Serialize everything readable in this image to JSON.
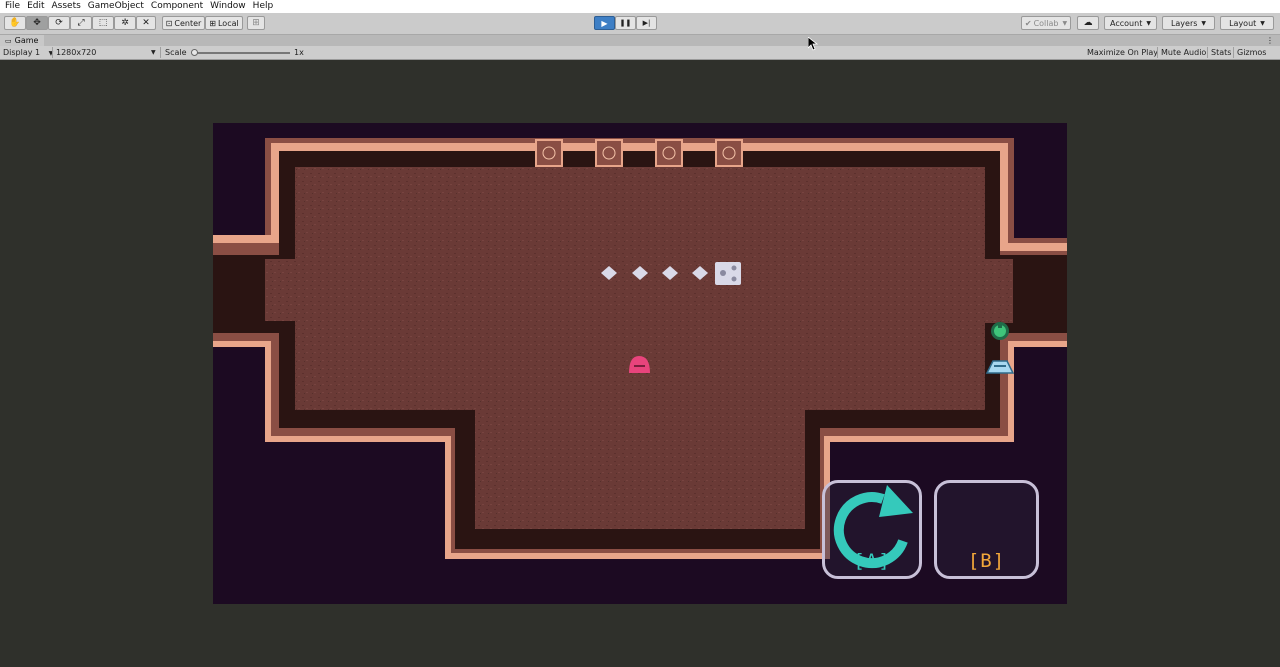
{
  "menubar": {
    "items": [
      "File",
      "Edit",
      "Assets",
      "GameObject",
      "Component",
      "Window",
      "Help"
    ]
  },
  "toolbar": {
    "pivot_label": "Center",
    "space_label": "Local",
    "collab_label": "Collab",
    "account_label": "Account",
    "layers_label": "Layers",
    "layout_label": "Layout",
    "tool_icons": [
      "hand-icon",
      "move-icon",
      "rotate-icon",
      "scale-icon",
      "rect-icon",
      "transform-icon",
      "custom-tool-icon"
    ],
    "play_state": "playing"
  },
  "game_tab": {
    "title": "Game"
  },
  "game_view": {
    "display": "Display 1",
    "resolution": "1280x720",
    "scale_label": "Scale",
    "scale_value": "1x",
    "maximize_on_play": "Maximize On Play",
    "mute_audio": "Mute Audio",
    "stats": "Stats",
    "gizmos": "Gizmos"
  },
  "game": {
    "button_a_label": "[A]",
    "button_b_label": "[B]",
    "colors": {
      "void": "#1c0a22",
      "floor": "#6a3a36",
      "floor_shadow": "#2a1412",
      "wall_trim": "#e8a58a",
      "wall_trim_dark": "#8a4e44",
      "player": "#e8447c",
      "snake": "#d9d9e8",
      "button_a_icon": "#35c9bb",
      "button_b_label": "#f2a73a"
    }
  }
}
